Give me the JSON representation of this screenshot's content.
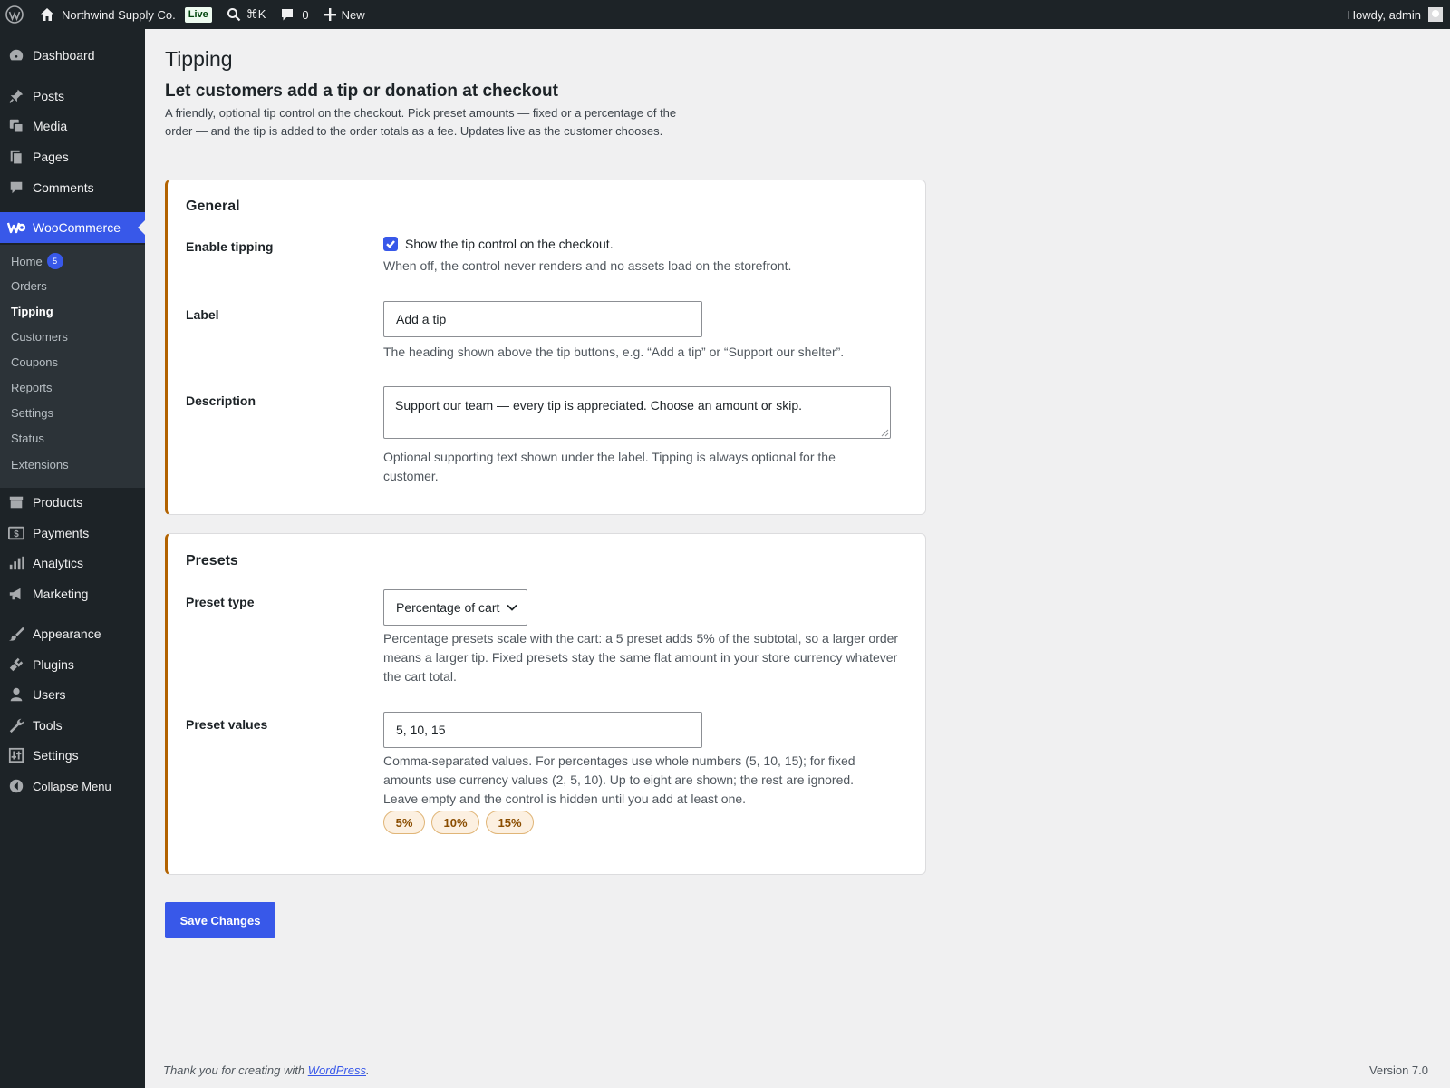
{
  "admin_bar": {
    "site_name": "Northwind Supply Co.",
    "site_status": "Live",
    "search_shortcut": "⌘K",
    "comments_count": "0",
    "new_label": "New",
    "greeting": "Howdy, admin"
  },
  "sidebar": {
    "items": [
      {
        "label": "Dashboard",
        "icon": "dashboard-icon"
      },
      {
        "label": "Posts",
        "icon": "pin-icon"
      },
      {
        "label": "Media",
        "icon": "media-icon"
      },
      {
        "label": "Pages",
        "icon": "pages-icon"
      },
      {
        "label": "Comments",
        "icon": "comment-icon"
      },
      {
        "label": "WooCommerce",
        "icon": "woocommerce-icon",
        "current": true
      },
      {
        "label": "Products",
        "icon": "archive-icon"
      },
      {
        "label": "Payments",
        "icon": "money-icon"
      },
      {
        "label": "Analytics",
        "icon": "bar-chart-icon"
      },
      {
        "label": "Marketing",
        "icon": "megaphone-icon"
      },
      {
        "label": "Appearance",
        "icon": "brush-icon"
      },
      {
        "label": "Plugins",
        "icon": "plug-icon"
      },
      {
        "label": "Users",
        "icon": "user-icon"
      },
      {
        "label": "Tools",
        "icon": "wrench-icon"
      },
      {
        "label": "Settings",
        "icon": "sliders-icon"
      },
      {
        "label": "Collapse Menu",
        "icon": "collapse-icon"
      }
    ],
    "submenu": [
      {
        "label": "Home",
        "badge": "5"
      },
      {
        "label": "Orders"
      },
      {
        "label": "Tipping",
        "current": true
      },
      {
        "label": "Customers"
      },
      {
        "label": "Coupons"
      },
      {
        "label": "Reports"
      },
      {
        "label": "Settings"
      },
      {
        "label": "Status"
      },
      {
        "label": "Extensions"
      }
    ]
  },
  "page": {
    "title": "Tipping",
    "heading": "Let customers add a tip or donation at checkout",
    "description": "A friendly, optional tip control on the checkout. Pick preset amounts — fixed or a percentage of the order — and the tip is added to the order totals as a fee. Updates live as the customer chooses."
  },
  "general": {
    "title": "General",
    "enable_label": "Enable tipping",
    "enable_checked": true,
    "enable_checkbox_text": "Show the tip control on the checkout.",
    "enable_desc": "When off, the control never renders and no assets load on the storefront.",
    "label_label": "Label",
    "label_value": "Add a tip",
    "label_desc": "The heading shown above the tip buttons, e.g. “Add a tip” or “Support our shelter”.",
    "description_label": "Description",
    "description_value": "Support our team — every tip is appreciated. Choose an amount or skip.",
    "description_desc": "Optional supporting text shown under the label. Tipping is always optional for the customer."
  },
  "presets": {
    "title": "Presets",
    "type_label": "Preset type",
    "type_value": "Percentage of cart",
    "type_desc": "Percentage presets scale with the cart: a 5 preset adds 5% of the subtotal, so a larger order means a larger tip. Fixed presets stay the same flat amount in your store currency whatever the cart total.",
    "values_label": "Preset values",
    "values_value": "5, 10, 15",
    "values_desc": "Comma-separated values. For percentages use whole numbers (5, 10, 15); for fixed amounts use currency values (2, 5, 10). Up to eight are shown; the rest are ignored. Leave empty and the control is hidden until you add at least one.",
    "chips": [
      "5%",
      "10%",
      "15%"
    ]
  },
  "save_label": "Save Changes",
  "footer": {
    "thanks_prefix": "Thank you for creating with ",
    "thanks_link": "WordPress",
    "thanks_suffix": ".",
    "version": "Version 7.0"
  }
}
